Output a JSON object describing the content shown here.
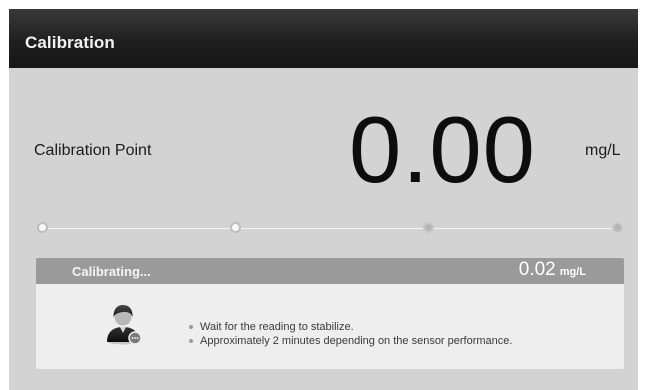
{
  "header": {
    "title": "Calibration"
  },
  "calibration": {
    "point_label": "Calibration Point",
    "value": "0.00",
    "unit": "mg/L"
  },
  "progress": {
    "total_steps": 4,
    "completed_steps": 2
  },
  "status_panel": {
    "status": "Calibrating...",
    "reading_value": "0.02",
    "reading_unit": "mg/L",
    "avatar_icon": "operator-avatar-icon",
    "tips": [
      "Wait for the reading to stabilize.",
      "Approximately 2 minutes depending on the sensor performance."
    ]
  },
  "colors": {
    "titlebar": "#1f1f1f",
    "background": "#d3d3d3",
    "panel_header": "#9a9a9a",
    "panel_body": "#eeeeee"
  }
}
